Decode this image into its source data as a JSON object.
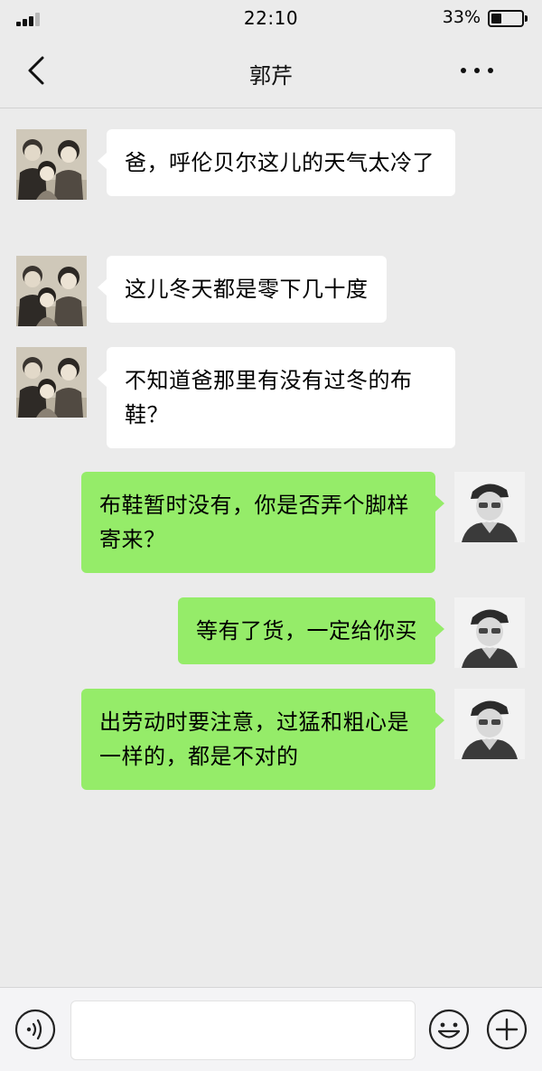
{
  "status_bar": {
    "time": "22:10",
    "battery_percent": "33%",
    "battery_level": 0.33,
    "signal_bars": 3
  },
  "header": {
    "title": "郭芹",
    "back_icon": "chevron-left-icon",
    "more_icon": "more-dots-icon"
  },
  "messages": [
    {
      "side": "in",
      "text": "爸，呼伦贝尔这儿的天气太冷了"
    },
    {
      "side": "in",
      "text": "这儿冬天都是零下几十度"
    },
    {
      "side": "in",
      "text": "不知道爸那里有没有过冬的布鞋？"
    },
    {
      "side": "out",
      "text": "布鞋暂时没有，你是否弄个脚样寄来？"
    },
    {
      "side": "out",
      "text": "等有了货，一定给你买"
    },
    {
      "side": "out",
      "text": "出劳动时要注意，过猛和粗心是一样的，都是不对的"
    }
  ],
  "input_bar": {
    "voice_icon": "voice-icon",
    "text_value": "",
    "emoji_icon": "emoji-icon",
    "plus_icon": "plus-icon"
  },
  "colors": {
    "background": "#ebebeb",
    "incoming_bubble": "#ffffff",
    "outgoing_bubble": "#95ec69"
  }
}
